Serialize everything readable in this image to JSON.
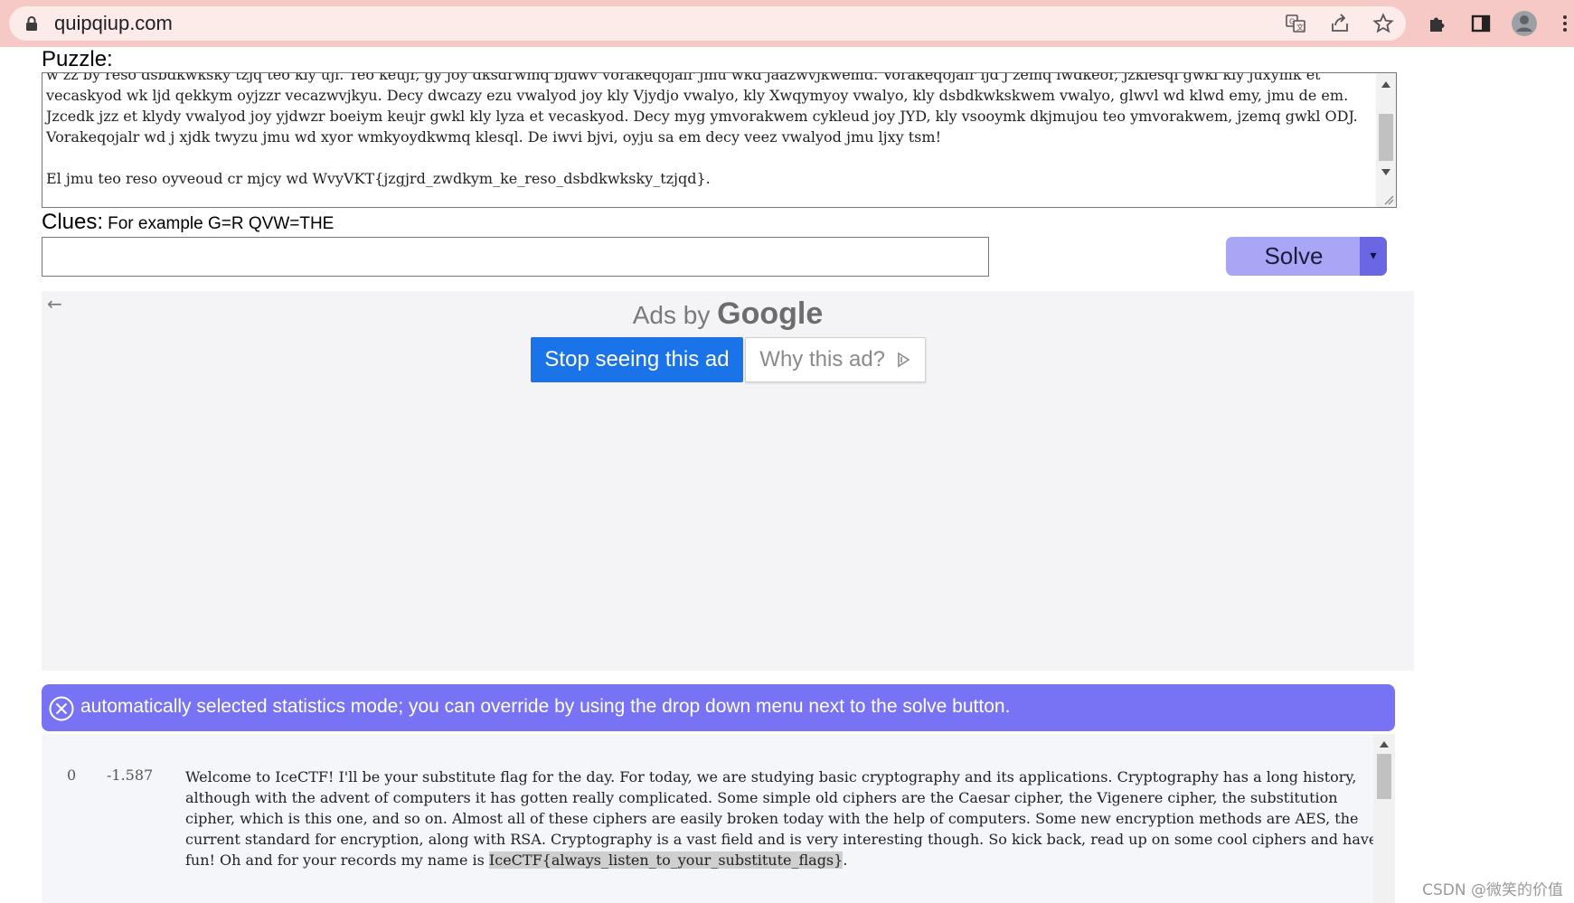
{
  "browser": {
    "url": "quipqiup.com",
    "icons": [
      "lock-icon",
      "translate-icon",
      "share-icon",
      "star-icon",
      "extensions-icon",
      "side-panel-icon",
      "profile-icon",
      "menu-icon"
    ]
  },
  "puzzle": {
    "label": "Puzzle:",
    "text": "w zz by reso dsbdkwksky tzjq teo kly uji. Teo keujr, gy joy dksdrwmq bjdwv vorakeqojalr jmu wkd jaazwvjkwemd. Vorakeqojalr ljd j zemq lwdkeor, jzklesql gwkl kly juxymk et vecaskyod wk ljd qekkym oyjzzr vecazwvjkyu. Decy dwcazy ezu vwalyod joy kly Vjydjo vwalyo, kly Xwqymyoy vwalyo, kly dsbdkwkskwem vwalyo, glwvl wd klwd emy, jmu de em. Jzcedk jzz et klydy vwalyod joy yjdwzr boeiym keujr gwkl kly lyza et vecaskyod. Decy myg ymvorakwem cykleud joy JYD, kly vsooymk dkjmujou teo ymvorakwem, jzemq gwkl ODJ. Vorakeqojalr wd j xjdk twyzu jmu wd xyor wmkyoydkwmq klesql. De iwvi bjvi, oyju sa em decy veez vwalyod jmu ljxy tsm!\n\nEl jmu teo reso oyveoud cr mjcy wd WvyVKT{jzgjrd_zwdkym_ke_reso_dsbdkwksky_tzjqd}."
  },
  "clues": {
    "label": "Clues:",
    "hint": "For example G=R QVW=THE",
    "value": ""
  },
  "solve": {
    "label": "Solve",
    "dropdown_glyph": "▾"
  },
  "ad": {
    "back_glyph": "←",
    "ads_by": "Ads by",
    "brand": "Google",
    "stop_label": "Stop seeing this ad",
    "why_label": "Why this ad?"
  },
  "banner": {
    "text": "automatically selected statistics mode; you can override by using the drop down menu next to the solve button."
  },
  "result": {
    "index": "0",
    "score": "-1.587",
    "text_before": "Welcome to IceCTF! I'll be your substitute flag for the day. For today, we are studying basic cryptography and its applications. Cryptography has a long history, although with the advent of computers it has gotten really complicated. Some simple old ciphers are the Caesar cipher, the Vigenere cipher, the substitution cipher, which is this one, and so on. Almost all of these ciphers are easily broken today with the help of computers. Some new encryption methods are AES, the current standard for encryption, along with RSA. Cryptography is a vast field and is very interesting though. So kick back, read up on some cool ciphers and have fun! Oh and for your records my name is ",
    "flag": "IceCTF{always_listen_to_your_substitute_flags}",
    "text_after": "."
  },
  "watermark": "CSDN @微笑的价值",
  "colors": {
    "chrome": "#f7c9c6",
    "solve_button": "#a9a6f5",
    "solve_dropdown": "#6b66e4",
    "banner": "#7873f5",
    "stop_ad": "#1a73e8"
  }
}
